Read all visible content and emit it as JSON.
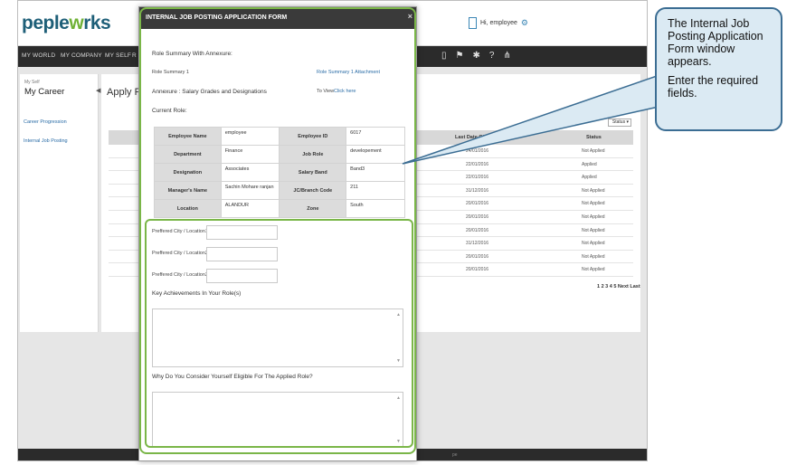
{
  "app": {
    "logo_a": "pe",
    "logo_b": "ple",
    "logo_c": "w",
    "logo_d": "rks",
    "user_label": "Hi, employee"
  },
  "nav": {
    "items": [
      "MY WORLD",
      "MY COMPANY",
      "MY SELF",
      "R"
    ]
  },
  "sidebar": {
    "small_label": "My Self",
    "title": "My Career",
    "links": [
      "Career Progression",
      "Internal Job Posting"
    ]
  },
  "content": {
    "title": "Apply For",
    "filter_value": "Status",
    "columns": [
      "Last Date Of A",
      "Status"
    ],
    "rows": [
      {
        "date": "24/01/2016",
        "status": "Not Applied"
      },
      {
        "date": "22/01/2016",
        "status": "Applied"
      },
      {
        "date": "22/01/2016",
        "status": "Applied"
      },
      {
        "date": "31/12/2016",
        "status": "Not Applied"
      },
      {
        "date": "20/01/2016",
        "status": "Not Applied"
      },
      {
        "date": "20/01/2016",
        "status": "Not Applied"
      },
      {
        "date": "20/01/2016",
        "status": "Not Applied"
      },
      {
        "date": "31/12/2016",
        "status": "Not Applied"
      },
      {
        "date": "20/01/2016",
        "status": "Not Applied"
      },
      {
        "date": "20/01/2016",
        "status": "Not Applied"
      }
    ],
    "pager": "1 2 3 4 5 Next Last"
  },
  "modal": {
    "title": "INTERNAL JOB POSTING APPLICATION FORM",
    "close": "×",
    "role_summary_heading": "Role Summary With Annexure:",
    "role_summary_label": "Role Summary 1",
    "role_summary_link": "Role Summary 1 Attachment",
    "annexure_label": "Annexure : Salary Grades and Designations",
    "annexure_view": "To View",
    "annexure_link": "Click here",
    "current_role_heading": "Current Role:",
    "role_rows": [
      {
        "l1": "Employee Name",
        "v1": "employee",
        "l2": "Employee ID",
        "v2": "6017"
      },
      {
        "l1": "Department",
        "v1": "Finance",
        "l2": "Job Role",
        "v2": "developement"
      },
      {
        "l1": "Designation",
        "v1": "Associates",
        "l2": "Salary Band",
        "v2": "Band3"
      },
      {
        "l1": "Manager's Name",
        "v1": "Sachin Mohare ranjan",
        "l2": "JC/Branch Code",
        "v2": "211"
      },
      {
        "l1": "Location",
        "v1": "ALANDUR",
        "l2": "Zone",
        "v2": "South"
      }
    ],
    "city1_label": "Preffered City / Location1",
    "city2_label": "Preffered City / Location2",
    "city3_label": "Preffered City / Location3",
    "achievements_label": "Key Achievements In Your Role(s)",
    "eligible_label": "Why Do You Consider Yourself Eligible For The Applied Role?"
  },
  "callout": {
    "line1": "The Internal  Job Posting Application Form window appears.",
    "line2": "Enter the required fields."
  },
  "colors": {
    "highlight": "#7ab648",
    "callout_border": "#3b6d93",
    "callout_bg": "#dbeaf3"
  }
}
